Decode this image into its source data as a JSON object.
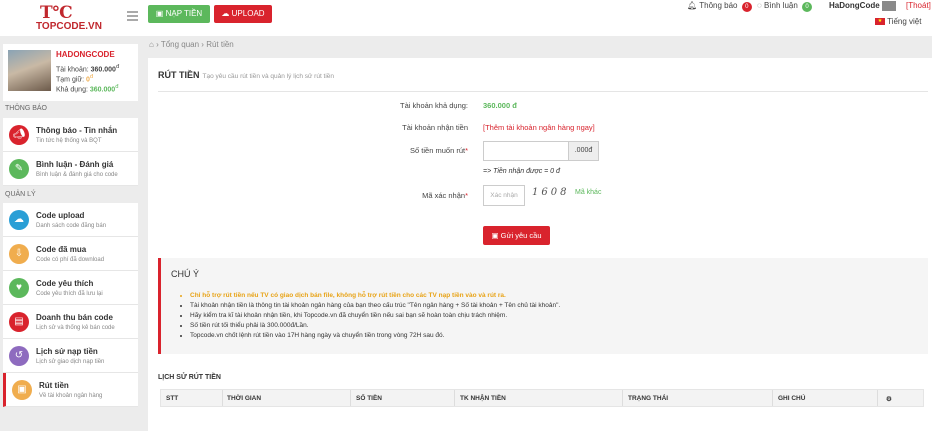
{
  "app": {
    "logo_text": "TOPCODE.VN",
    "logo_mark": "T°C",
    "accent": "#d9232d"
  },
  "header": {
    "nap_tien": "NẠP TIỀN",
    "upload": "UPLOAD",
    "notifications_label": "Thông báo",
    "notifications_count": "0",
    "comments_label": "Bình luận",
    "comments_count": "0",
    "username": "HaDongCode",
    "logout": "[Thoát]",
    "language": "Tiếng việt"
  },
  "profile": {
    "name": "HADONGCODE",
    "balance_label": "Tài khoản:",
    "balance": "360.000",
    "frozen_label": "Tạm giữ:",
    "frozen": "0",
    "available_label": "Khả dụng:",
    "available": "360.000",
    "currency": "đ"
  },
  "sidebar": {
    "section_notify": "THÔNG BÁO",
    "section_manage": "QUẢN LÝ",
    "items": [
      {
        "title": "Thông báo - Tin nhắn",
        "sub": "Tin tức hệ thống và BQT",
        "icon": "bullhorn-icon",
        "color": "#d9232d"
      },
      {
        "title": "Bình luận - Đánh giá",
        "sub": "Bình luận & đánh giá cho code",
        "icon": "comment-icon",
        "color": "#5cb85c"
      },
      {
        "title": "Code upload",
        "sub": "Danh sách code đăng bán",
        "icon": "upload-cloud-icon",
        "color": "#2a9fd6"
      },
      {
        "title": "Code đã mua",
        "sub": "Code có phí đã download",
        "icon": "download-icon",
        "color": "#f0ad4e"
      },
      {
        "title": "Code yêu thích",
        "sub": "Code yêu thích đã lưu lại",
        "icon": "heart-icon",
        "color": "#5cb85c"
      },
      {
        "title": "Doanh thu bán code",
        "sub": "Lịch sử và thống kê bán code",
        "icon": "chart-icon",
        "color": "#d9232d"
      },
      {
        "title": "Lịch sử nạp tiền",
        "sub": "Lịch sử giao dịch nạp tiền",
        "icon": "history-icon",
        "color": "#8e6bbf"
      },
      {
        "title": "Rút tiền",
        "sub": "Về tài khoản ngân hàng",
        "icon": "bank-icon",
        "color": "#f0ad4e"
      }
    ]
  },
  "breadcrumb": {
    "home": "Tổng quan",
    "current": "Rút tiền"
  },
  "page": {
    "title": "RÚT TIỀN",
    "subtitle": "Tạo yêu cầu rút tiền và quản lý lịch sử rút tiền"
  },
  "form": {
    "available_label": "Tài khoản khả dụng:",
    "available_value": "360.000 đ",
    "bank_label": "Tài khoản nhận tiền",
    "bank_link": "[Thêm tài khoản ngân hàng ngay]",
    "amount_label": "Số tiền muốn rút",
    "amount_addon": ".000đ",
    "receive_note": "=> Tiền nhận được = 0 đ",
    "captcha_label": "Mã xác nhận",
    "captcha_placeholder": "Xác nhận",
    "captcha_image": "1608",
    "captcha_refresh": "Mã khác",
    "submit": "Gửi yêu cầu"
  },
  "notes": {
    "title": "CHÚ Ý",
    "items": [
      "Chỉ hỗ trợ rút tiền nếu TV có giao dịch bán file, không hỗ trợ rút tiền cho các TV nạp tiền vào và rút ra.",
      "Tài khoản nhận tiền là thông tin tài khoản ngân hàng của bạn theo cấu trúc \"Tên ngân hàng + Số tài khoản + Tên chủ tài khoản\".",
      "Hãy kiểm tra kĩ tài khoản nhận tiền, khi Topcode.vn đã chuyển tiền nếu sai bạn sẽ hoàn toàn chịu trách nhiệm.",
      "Số tiền rút tối thiểu phải là 300.000đ/Lần.",
      "Topcode.vn chốt lệnh rút tiền vào 17H hàng ngày và chuyển tiền trong vòng 72H sau đó."
    ]
  },
  "history": {
    "title": "LỊCH SỬ RÚT TIỀN",
    "columns": [
      "STT",
      "THỜI GIAN",
      "SỐ TIỀN",
      "TK NHẬN TIỀN",
      "TRẠNG THÁI",
      "GHI CHÚ",
      "⚙"
    ]
  }
}
